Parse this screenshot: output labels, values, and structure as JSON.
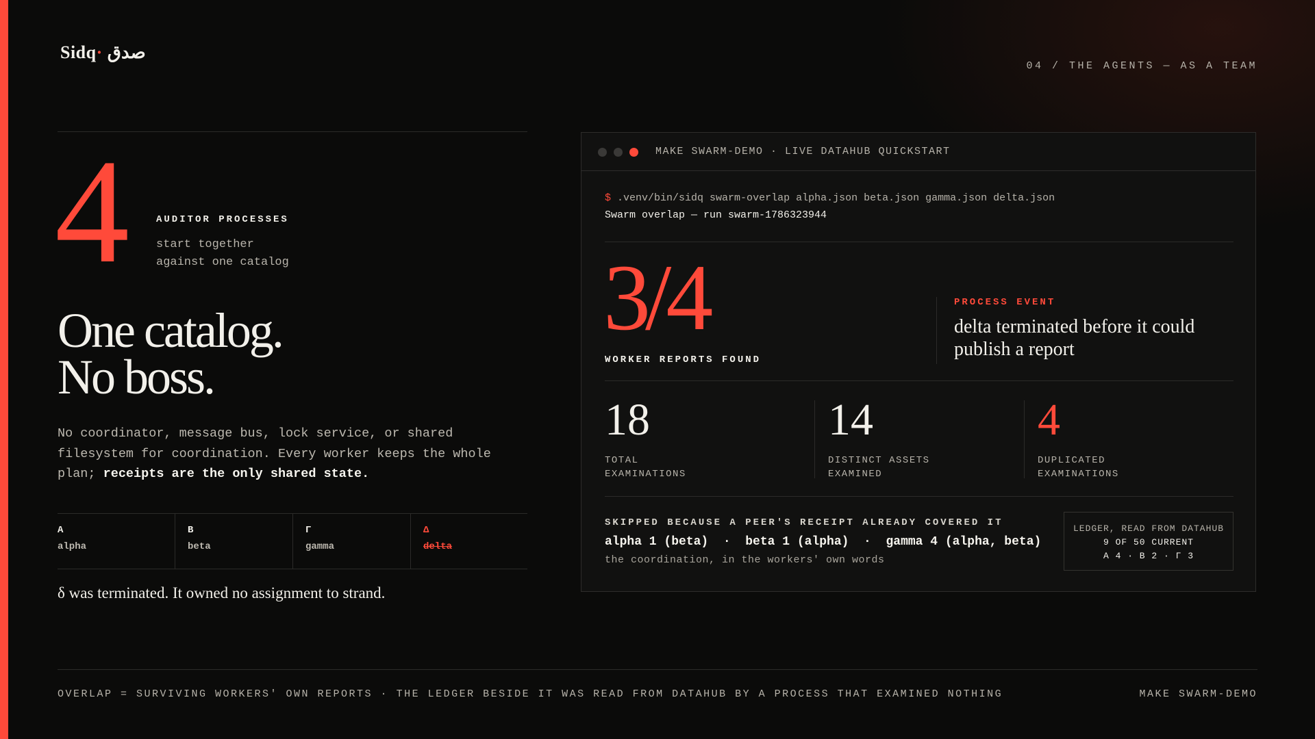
{
  "brand": {
    "name": "Sidq",
    "arabic": "صدق"
  },
  "section_label": "04 / THE AGENTS — AS A TEAM",
  "hero": {
    "count": "4",
    "label": "AUDITOR PROCESSES",
    "sub_line1": "start together",
    "sub_line2": "against one catalog",
    "headline_line1": "One catalog.",
    "headline_line2": "No boss.",
    "para_plain": "No coordinator, message bus, lock service, or shared filesystem for coordination. Every worker keeps the whole plan; ",
    "para_bold": "receipts are the only shared state."
  },
  "workers": [
    {
      "glyph": "Α",
      "name": "alpha",
      "status": "alive"
    },
    {
      "glyph": "Β",
      "name": "beta",
      "status": "alive"
    },
    {
      "glyph": "Γ",
      "name": "gamma",
      "status": "alive"
    },
    {
      "glyph": "Δ",
      "name": "delta",
      "status": "terminated"
    }
  ],
  "termination_note": "δ was terminated. It owned no assignment to strand.",
  "terminal": {
    "title": "MAKE SWARM-DEMO · LIVE DATAHUB QUICKSTART",
    "prompt": "$",
    "command": ".venv/bin/sidq swarm-overlap alpha.json beta.json gamma.json delta.json",
    "output": "Swarm overlap — run swarm-1786323944",
    "reports_found": "3/4",
    "reports_label": "WORKER REPORTS FOUND",
    "event_label": "PROCESS EVENT",
    "event_text": "delta terminated before it could publish a report",
    "stats": [
      {
        "value": "18",
        "label_line1": "TOTAL",
        "label_line2": "EXAMINATIONS",
        "highlight": false
      },
      {
        "value": "14",
        "label_line1": "DISTINCT ASSETS",
        "label_line2": "EXAMINED",
        "highlight": false
      },
      {
        "value": "4",
        "label_line1": "DUPLICATED",
        "label_line2": "EXAMINATIONS",
        "highlight": true
      }
    ],
    "skip_title": "SKIPPED BECAUSE A PEER'S RECEIPT ALREADY COVERED IT",
    "skip_items": "alpha 1 (beta)  ·  beta 1 (alpha)  ·  gamma 4 (alpha, beta)",
    "skip_note": "the coordination, in the workers' own words",
    "ledger": {
      "header": "LEDGER, READ FROM DATAHUB",
      "current": "9 OF 50 CURRENT",
      "breakdown": "Α 4 · Β 2 · Γ 3"
    }
  },
  "footer": {
    "left": "OVERLAP = SURVIVING WORKERS' OWN REPORTS · THE LEDGER BESIDE IT WAS READ FROM DATAHUB BY A PROCESS THAT EXAMINED NOTHING",
    "right": "MAKE SWARM-DEMO"
  },
  "colors": {
    "accent": "#ff4a3a",
    "background": "#0b0b0a",
    "panel": "#111110",
    "text": "#f2f0ea",
    "muted": "#b7b3aa"
  }
}
